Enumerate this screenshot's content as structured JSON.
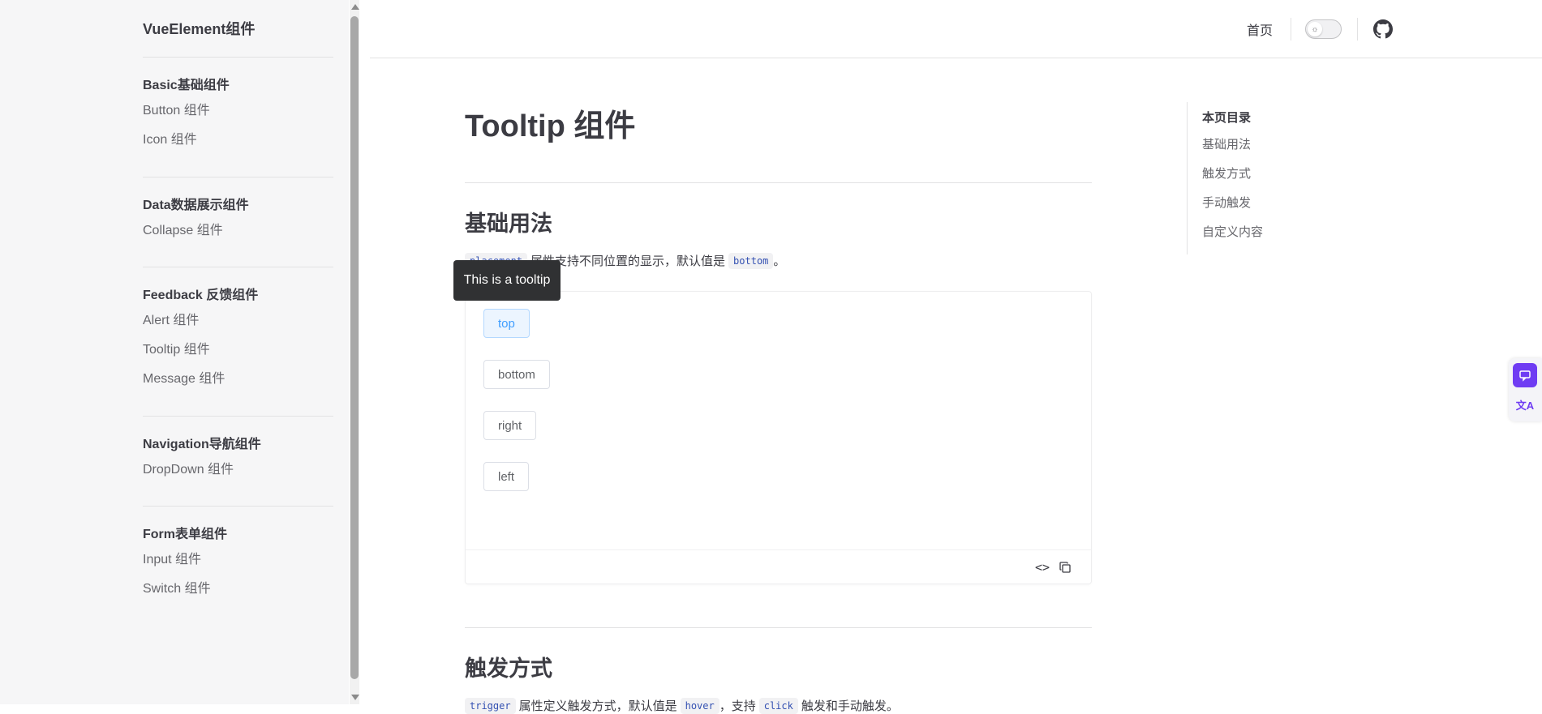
{
  "sidebar": {
    "brand": "VueElement组件",
    "groups": [
      {
        "title": "Basic基础组件",
        "items": [
          "Button 组件",
          "Icon 组件"
        ]
      },
      {
        "title": "Data数据展示组件",
        "items": [
          "Collapse 组件"
        ]
      },
      {
        "title": "Feedback 反馈组件",
        "items": [
          "Alert 组件",
          "Tooltip 组件",
          "Message 组件"
        ]
      },
      {
        "title": "Navigation导航组件",
        "items": [
          "DropDown 组件"
        ]
      },
      {
        "title": "Form表单组件",
        "items": [
          "Input 组件",
          "Switch 组件"
        ]
      }
    ]
  },
  "nav": {
    "home": "首页",
    "theme_icon": "sun-icon",
    "github_icon": "github-icon"
  },
  "main": {
    "title": "Tooltip 组件",
    "sections": [
      {
        "heading": "基础用法",
        "desc_code": "placement",
        "desc_text": "属性支持不同位置的显示，默认值是",
        "desc_code2": "bottom",
        "desc_end": "。"
      },
      {
        "heading": "触发方式",
        "desc_code": "trigger",
        "desc_text": "属性定义触发方式，默认值是",
        "desc_code2": "hover",
        "desc_mid": "，支持",
        "desc_code3": "click",
        "desc_end": "触发和手动触发。"
      }
    ],
    "demo": {
      "buttons": [
        "top",
        "bottom",
        "right",
        "left"
      ],
      "active": "top",
      "tooltip": "This is a tooltip",
      "code_toggle": "<>"
    }
  },
  "toc": {
    "title": "本页目录",
    "items": [
      "基础用法",
      "触发方式",
      "手动触发",
      "自定义内容"
    ]
  },
  "colors": {
    "accent": "#409eff",
    "widget": "#6f3cf3"
  },
  "floating": {
    "top_icon": "translate-panel-icon",
    "bottom_icon": "language-icon",
    "bottom_label": "文A"
  }
}
